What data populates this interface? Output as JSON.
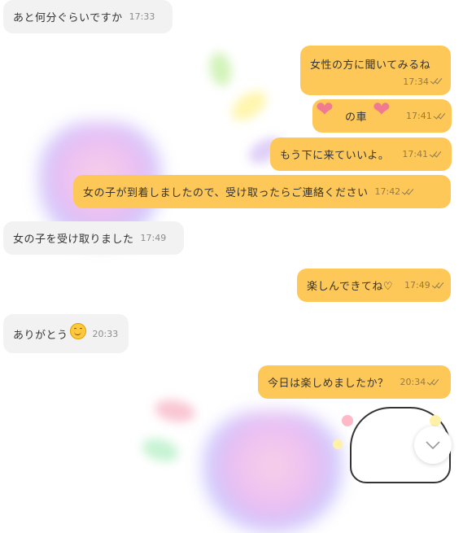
{
  "messages": [
    {
      "text": "あと何分ぐらいですか",
      "time": "17:33"
    },
    {
      "text": "女性の方に聞いてみるね",
      "time": "17:34"
    },
    {
      "text": "の車",
      "time": "17:41"
    },
    {
      "text": "もう下に来ていいよ。",
      "time": "17:41"
    },
    {
      "text": "女の子が到着しましたので、受け取ったらご連絡ください",
      "time": "17:42"
    },
    {
      "text": "女の子を受け取りました",
      "time": "17:49"
    },
    {
      "text": "楽しんできてね♡",
      "time": "17:49"
    },
    {
      "text": "ありがとう",
      "time": "20:33"
    },
    {
      "text": "今日は楽しめましたか？",
      "time": "20:34"
    }
  ],
  "icons": {
    "read_receipt": "double-check-icon",
    "heart_emoji": "heart-emoji-icon",
    "smile_emoji": "smile-emoji-icon",
    "scroll_down": "chevron-down-icon"
  },
  "colors": {
    "incoming_bubble": "#f2f2f2",
    "outgoing_bubble": "#fdc857"
  }
}
